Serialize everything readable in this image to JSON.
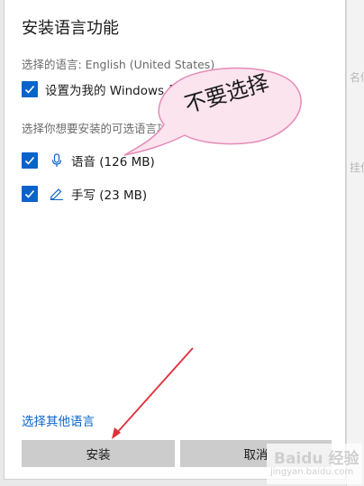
{
  "dialog": {
    "title": "安装语言功能",
    "selected_language_text": "选择的语言: English (United States)",
    "display_language_option": {
      "label": "设置为我的 Windows 显示语言",
      "checked": true
    },
    "optional_features_heading": "选择你想要安装的可选语言功能",
    "features": [
      {
        "label": "语音 (126 MB)",
        "icon": "microphone-icon",
        "checked": true
      },
      {
        "label": "手写 (23 MB)",
        "icon": "pen-icon",
        "checked": true
      }
    ],
    "other_language_link": "选择其他语言",
    "install_button": "安装",
    "cancel_button": "取消"
  },
  "background": {
    "fragment_1": "名似",
    "fragment_2": "挂住"
  },
  "annotation": {
    "bubble_text": "不要选择"
  },
  "watermark": {
    "main": "Baidu 经验",
    "sub": "jingyan.baidu.com"
  },
  "colors": {
    "accent": "#0a63c9",
    "button_bg": "#cccccc",
    "bubble_fill": "#fce4ef",
    "bubble_border": "#e58ab8",
    "arrow": "#e0303a"
  }
}
